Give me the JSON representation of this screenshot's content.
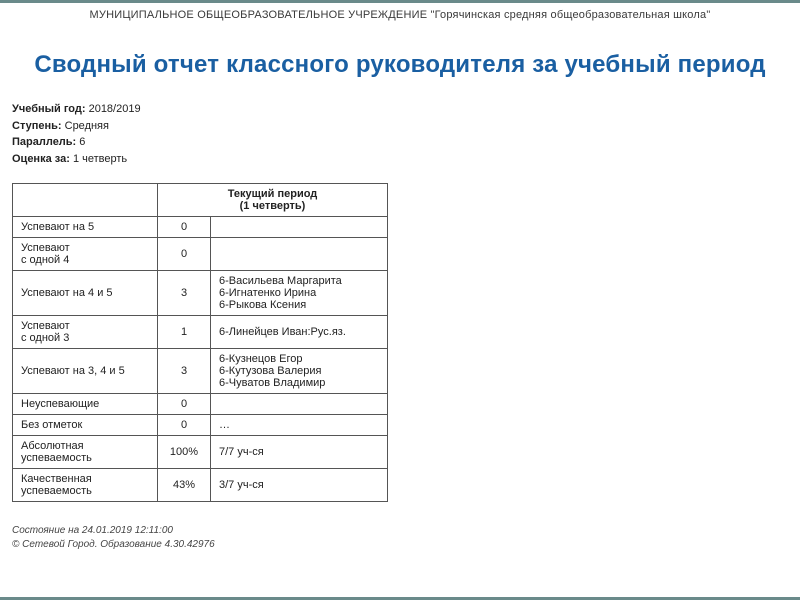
{
  "org": "МУНИЦИПАЛЬНОЕ ОБЩЕОБРАЗОВАТЕЛЬНОЕ УЧРЕЖДЕНИЕ \"Горячинская средняя общеобразовательная школа\"",
  "title": "Сводный отчет классного руководителя за учебный период",
  "meta": {
    "year_label": "Учебный год:",
    "year_value": "2018/2019",
    "level_label": "Ступень:",
    "level_value": "Средняя",
    "parallel_label": "Параллель:",
    "parallel_value": "6",
    "grade_for_label": "Оценка за:",
    "grade_for_value": "1 четверть"
  },
  "table": {
    "period_header_line1": "Текущий период",
    "period_header_line2": "(1 четверть)",
    "rows": [
      {
        "label": "Успевают на 5",
        "count": "0",
        "details": ""
      },
      {
        "label": "Успевают\nс одной 4",
        "count": "0",
        "details": ""
      },
      {
        "label": "Успевают на 4 и 5",
        "count": "3",
        "details": "6-Васильева Маргарита\n6-Игнатенко Ирина\n6-Рыкова Ксения"
      },
      {
        "label": "Успевают\nс одной 3",
        "count": "1",
        "details": "6-Линейцев Иван:Рус.яз."
      },
      {
        "label": "Успевают на 3, 4 и 5",
        "count": "3",
        "details": "6-Кузнецов Егор\n6-Кутузова Валерия\n6-Чуватов Владимир"
      },
      {
        "label": "Неуспевающие",
        "count": "0",
        "details": ""
      },
      {
        "label": "Без отметок",
        "count": "0",
        "details": "…"
      },
      {
        "label": "Абсолютная успеваемость",
        "count": "100%",
        "details": "7/7 уч-ся"
      },
      {
        "label": "Качественная успеваемость",
        "count": "43%",
        "details": "3/7 уч-ся"
      }
    ]
  },
  "footer": {
    "timestamp": "Состояние на 24.01.2019 12:11:00",
    "copyright": "© Сетевой Город. Образование 4.30.42976"
  }
}
